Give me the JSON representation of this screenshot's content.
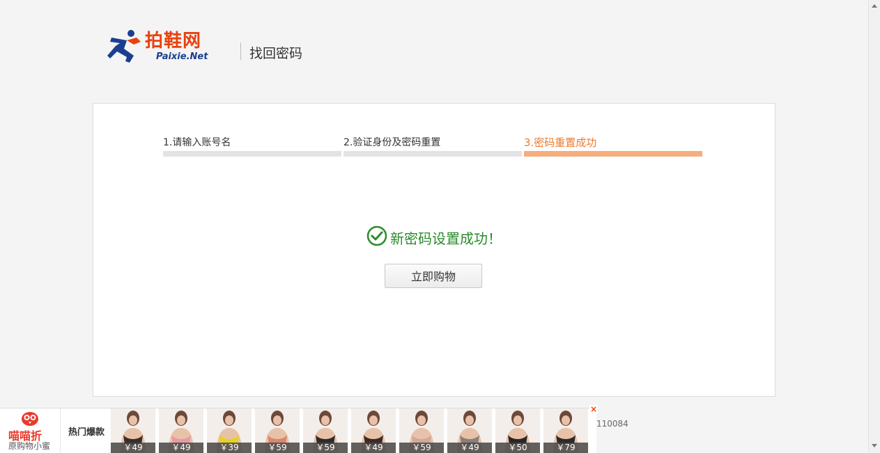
{
  "header": {
    "logo_cn": "拍鞋网",
    "logo_en": "Paixie.Net",
    "title": "找回密码"
  },
  "steps": [
    {
      "label": "1.请输入账号名",
      "active": false
    },
    {
      "label": "2.验证身份及密码重置",
      "active": false
    },
    {
      "label": "3.密码重置成功",
      "active": true
    }
  ],
  "success": {
    "message": "新密码设置成功！",
    "button": "立即购物"
  },
  "footer": {
    "partial_text": "110084"
  },
  "promo": {
    "brand_name": "喵喵折",
    "brand_sub": "原购物小蜜",
    "hot_label": "热门爆款",
    "close": "×",
    "products": [
      {
        "price": "￥49",
        "color": "#3a2e2a"
      },
      {
        "price": "￥49",
        "color": "#e79aa5"
      },
      {
        "price": "￥39",
        "color": "#e6d21f"
      },
      {
        "price": "￥59",
        "color": "#d9876e"
      },
      {
        "price": "￥59",
        "color": "#2f2b2c"
      },
      {
        "price": "￥49",
        "color": "#3b2a26"
      },
      {
        "price": "￥59",
        "color": "#cfa89a"
      },
      {
        "price": "￥49",
        "color": "#8a7f7c"
      },
      {
        "price": "￥50",
        "color": "#2a2523"
      },
      {
        "price": "￥79",
        "color": "#2d2a2b"
      }
    ]
  },
  "colors": {
    "accent": "#ef7a2a",
    "success": "#2b8b2b",
    "brand": "#e8420f"
  }
}
